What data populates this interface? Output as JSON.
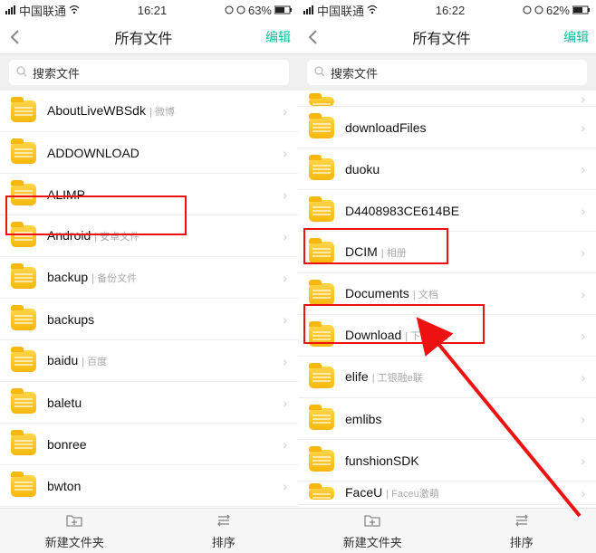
{
  "left": {
    "status": {
      "carrier": "中国联通",
      "time": "16:21",
      "battery": "63%"
    },
    "nav": {
      "title": "所有文件",
      "edit": "编辑"
    },
    "search": {
      "placeholder": "搜索文件"
    },
    "items": [
      {
        "name": "AboutLiveWBSdk",
        "sub": "| 微博"
      },
      {
        "name": "ADDOWNLOAD",
        "sub": ""
      },
      {
        "name": "ALIMP",
        "sub": ""
      },
      {
        "name": "Android",
        "sub": "| 安卓文件"
      },
      {
        "name": "backup",
        "sub": "| 备份文件"
      },
      {
        "name": "backups",
        "sub": ""
      },
      {
        "name": "baidu",
        "sub": "| 百度"
      },
      {
        "name": "baletu",
        "sub": ""
      },
      {
        "name": "bonree",
        "sub": ""
      },
      {
        "name": "bwton",
        "sub": ""
      }
    ],
    "bottom": {
      "new": "新建文件夹",
      "sort": "排序"
    }
  },
  "right": {
    "status": {
      "carrier": "中国联通",
      "time": "16:22",
      "battery": "62%"
    },
    "nav": {
      "title": "所有文件",
      "edit": "编辑"
    },
    "search": {
      "placeholder": "搜索文件"
    },
    "items": [
      {
        "name": "downloadFiles",
        "sub": ""
      },
      {
        "name": "duoku",
        "sub": ""
      },
      {
        "name": "D4408983CE614BE",
        "sub": ""
      },
      {
        "name": "DCIM",
        "sub": "| 相册"
      },
      {
        "name": "Documents",
        "sub": "| 文档"
      },
      {
        "name": "Download",
        "sub": "| 下载文件"
      },
      {
        "name": "elife",
        "sub": "| 工银融e联"
      },
      {
        "name": "emlibs",
        "sub": ""
      },
      {
        "name": "funshionSDK",
        "sub": ""
      },
      {
        "name": "FaceU",
        "sub": "| Faceu激萌"
      }
    ],
    "bottom": {
      "new": "新建文件夹",
      "sort": "排序"
    }
  }
}
